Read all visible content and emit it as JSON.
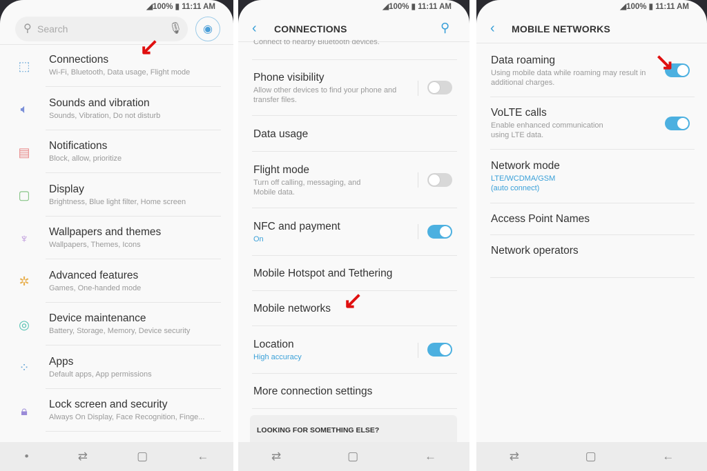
{
  "status": {
    "battery": "100%",
    "time": "11:11 AM"
  },
  "panel1": {
    "search_placeholder": "Search",
    "items": [
      {
        "title": "Connections",
        "subtitle": "Wi-Fi, Bluetooth, Data usage, Flight mode",
        "icon": "connections-icon",
        "color": "#6aa8d8"
      },
      {
        "title": "Sounds and vibration",
        "subtitle": "Sounds, Vibration, Do not disturb",
        "icon": "speaker-icon",
        "color": "#7a8fd8"
      },
      {
        "title": "Notifications",
        "subtitle": "Block, allow, prioritize",
        "icon": "notifications-icon",
        "color": "#e88a8a"
      },
      {
        "title": "Display",
        "subtitle": "Brightness, Blue light filter, Home screen",
        "icon": "display-icon",
        "color": "#7cc07c"
      },
      {
        "title": "Wallpapers and themes",
        "subtitle": "Wallpapers, Themes, Icons",
        "icon": "brush-icon",
        "color": "#b58ad8"
      },
      {
        "title": "Advanced features",
        "subtitle": "Games, One-handed mode",
        "icon": "gear-plus-icon",
        "color": "#e8b050"
      },
      {
        "title": "Device maintenance",
        "subtitle": "Battery, Storage, Memory, Device security",
        "icon": "maintenance-icon",
        "color": "#50c0b0"
      },
      {
        "title": "Apps",
        "subtitle": "Default apps, App permissions",
        "icon": "apps-icon",
        "color": "#6aa8d8"
      },
      {
        "title": "Lock screen and security",
        "subtitle": "Always On Display, Face Recognition, Finge...",
        "icon": "lock-icon",
        "color": "#9a8ad8"
      }
    ]
  },
  "panel2": {
    "title": "CONNECTIONS",
    "partial": "Connect to nearby Bluetooth devices.",
    "phone_visibility": {
      "title": "Phone visibility",
      "subtitle": "Allow other devices to find your phone and transfer files.",
      "on": false
    },
    "data_usage": "Data usage",
    "flight_mode": {
      "title": "Flight mode",
      "subtitle": "Turn off calling, messaging, and Mobile data.",
      "on": false
    },
    "nfc": {
      "title": "NFC and payment",
      "status": "On",
      "on": true
    },
    "hotspot": "Mobile Hotspot and Tethering",
    "mobile_networks": "Mobile networks",
    "location": {
      "title": "Location",
      "status": "High accuracy",
      "on": true
    },
    "more": "More connection settings",
    "looking": "LOOKING FOR SOMETHING ELSE?"
  },
  "panel3": {
    "title": "MOBILE NETWORKS",
    "data_roaming": {
      "title": "Data roaming",
      "subtitle": "Using mobile data while roaming may result in additional charges.",
      "on": true
    },
    "volte": {
      "title": "VoLTE calls",
      "subtitle": "Enable enhanced communication using LTE data.",
      "on": true
    },
    "network_mode": {
      "title": "Network mode",
      "value": "LTE/WCDMA/GSM",
      "value2": "(auto connect)"
    },
    "apn": "Access Point Names",
    "operators": "Network operators"
  },
  "colors": {
    "accent": "#4cb0e0",
    "annotation": "#e01010"
  }
}
